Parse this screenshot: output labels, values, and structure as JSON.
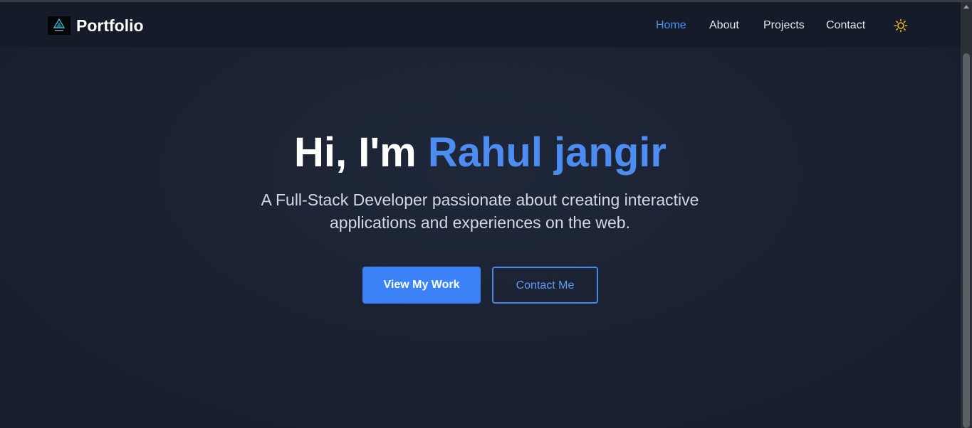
{
  "navbar": {
    "brand": "Portfolio",
    "links": [
      {
        "label": "Home",
        "active": true
      },
      {
        "label": "About",
        "active": false
      },
      {
        "label": "Projects",
        "active": false
      },
      {
        "label": "Contact",
        "active": false
      }
    ],
    "theme_toggle_icon": "sun-icon"
  },
  "hero": {
    "greeting": "Hi, I'm ",
    "name": "Rahul jangir",
    "subtitle": "A Full-Stack Developer passionate about creating interactive applications and experiences on the web.",
    "primary_button": "View My Work",
    "secondary_button": "Contact Me"
  },
  "colors": {
    "accent": "#3b82f6",
    "name_highlight": "#4d8cf0",
    "background": "#1a2233",
    "navbar": "#151b29",
    "sun": "#f5b52a"
  }
}
